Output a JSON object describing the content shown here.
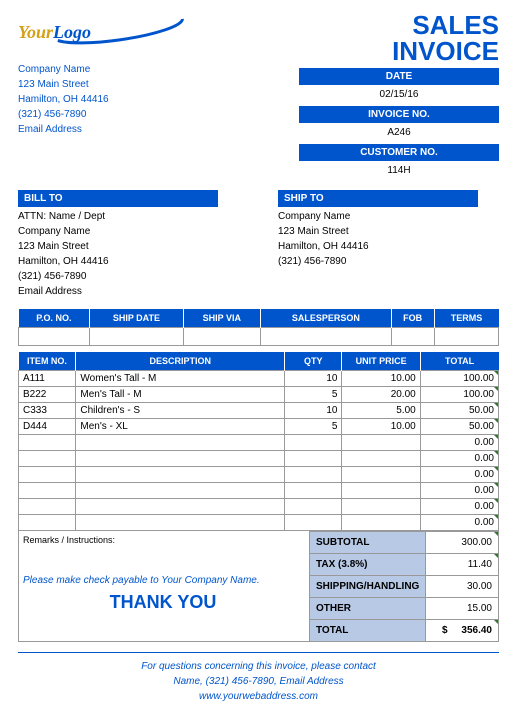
{
  "logo": {
    "your": "Your",
    "logo": "Logo"
  },
  "title": {
    "line1": "SALES",
    "line2": "INVOICE"
  },
  "company": {
    "name": "Company Name",
    "street": "123 Main Street",
    "city": "Hamilton, OH  44416",
    "phone": "(321) 456-7890",
    "email": "Email Address"
  },
  "meta": {
    "date_label": "DATE",
    "date_value": "02/15/16",
    "invoice_label": "INVOICE NO.",
    "invoice_value": "A246",
    "customer_label": "CUSTOMER NO.",
    "customer_value": "114H"
  },
  "billto": {
    "header": "BILL TO",
    "attn": "ATTN: Name / Dept",
    "name": "Company Name",
    "street": "123 Main Street",
    "city": "Hamilton, OH  44416",
    "phone": "(321) 456-7890",
    "email": "Email Address"
  },
  "shipto": {
    "header": "SHIP TO",
    "name": "Company Name",
    "street": "123 Main Street",
    "city": "Hamilton, OH  44416",
    "phone": "(321) 456-7890"
  },
  "ship_headers": {
    "po": "P.O. NO.",
    "date": "SHIP DATE",
    "via": "SHIP VIA",
    "sales": "SALESPERSON",
    "fob": "FOB",
    "terms": "TERMS"
  },
  "item_headers": {
    "no": "ITEM NO.",
    "desc": "DESCRIPTION",
    "qty": "QTY",
    "price": "UNIT PRICE",
    "total": "TOTAL"
  },
  "items": [
    {
      "no": "A111",
      "desc": "Women's Tall - M",
      "qty": "10",
      "price": "10.00",
      "total": "100.00"
    },
    {
      "no": "B222",
      "desc": "Men's Tall - M",
      "qty": "5",
      "price": "20.00",
      "total": "100.00"
    },
    {
      "no": "C333",
      "desc": "Children's - S",
      "qty": "10",
      "price": "5.00",
      "total": "50.00"
    },
    {
      "no": "D444",
      "desc": "Men's - XL",
      "qty": "5",
      "price": "10.00",
      "total": "50.00"
    }
  ],
  "empty_totals": [
    "0.00",
    "0.00",
    "0.00",
    "0.00",
    "0.00",
    "0.00"
  ],
  "remarks_label": "Remarks / Instructions:",
  "totals": {
    "subtotal_label": "SUBTOTAL",
    "subtotal_value": "300.00",
    "tax_label": "TAX (3.8%)",
    "tax_value": "11.40",
    "shipping_label": "SHIPPING/HANDLING",
    "shipping_value": "30.00",
    "other_label": "OTHER",
    "other_value": "15.00",
    "total_label": "TOTAL",
    "total_currency": "$",
    "total_value": "356.40"
  },
  "payable": "Please make check payable to Your Company Name.",
  "thanks": "THANK YOU",
  "footer": {
    "line1": "For questions concerning this invoice, please contact",
    "line2": "Name, (321) 456-7890, Email Address",
    "url": "www.yourwebaddress.com"
  }
}
